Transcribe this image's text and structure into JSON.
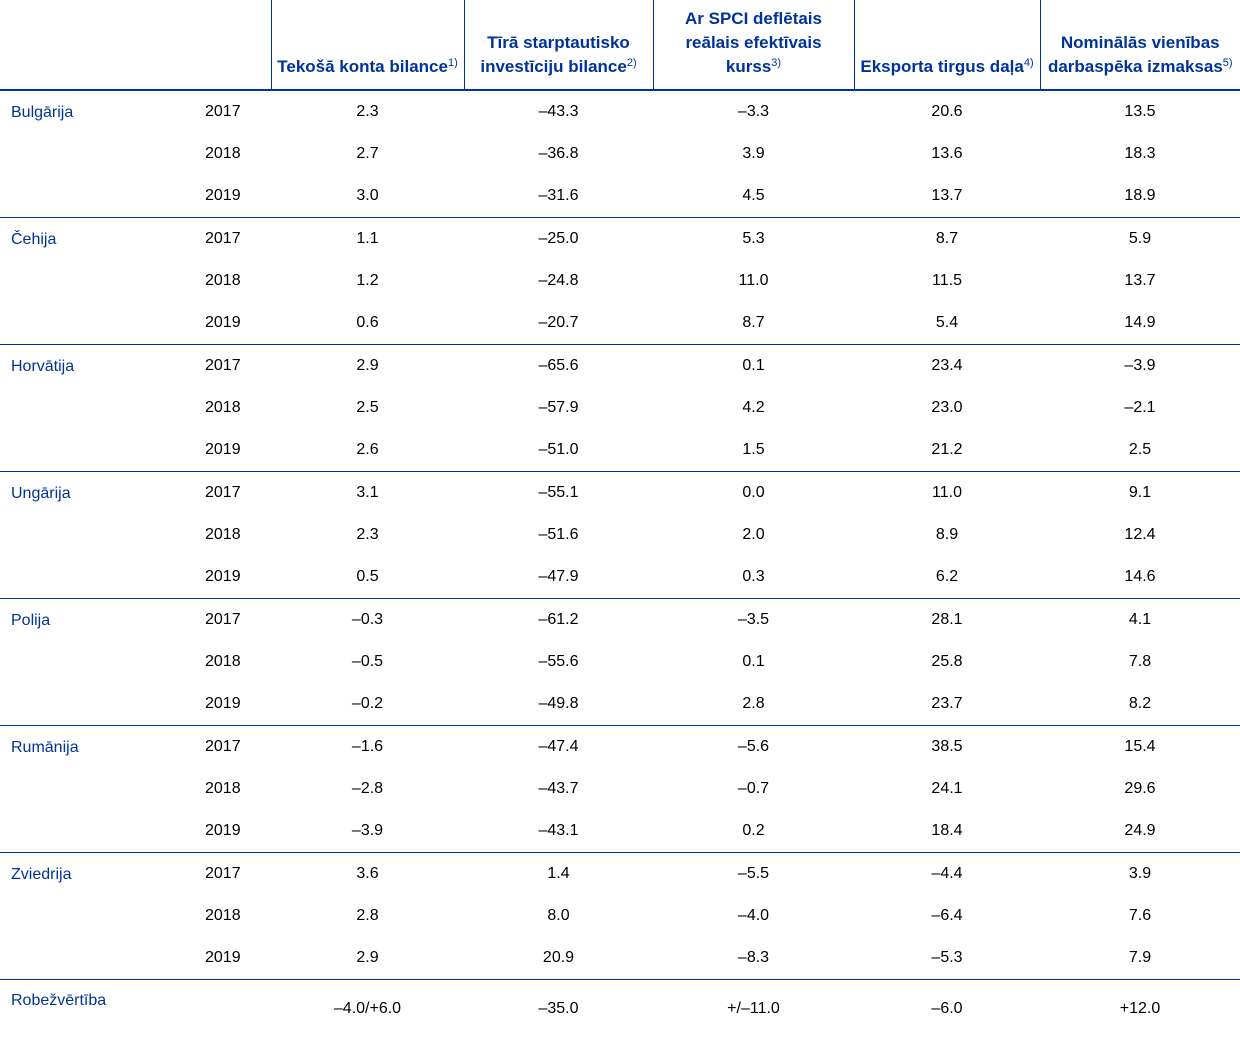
{
  "colors": {
    "accent": "#003399",
    "text": "#000000",
    "background": "#ffffff"
  },
  "header": {
    "columns": [
      {
        "label": "Tekošā konta bilance",
        "note": "1)"
      },
      {
        "label": "Tīrā starptautisko investīciju bilance",
        "note": "2)"
      },
      {
        "label": "Ar SPCI deflētais reālais efektīvais kurss",
        "note": "3)"
      },
      {
        "label": "Eksporta tirgus daļa",
        "note": "4)"
      },
      {
        "label": "Nominālās vienības darbaspēka izmaksas",
        "note": "5)"
      }
    ]
  },
  "groups": [
    {
      "country": "Bulgārija",
      "rows": [
        {
          "year": "2017",
          "values": [
            "2.3",
            "–43.3",
            "–3.3",
            "20.6",
            "13.5"
          ]
        },
        {
          "year": "2018",
          "values": [
            "2.7",
            "–36.8",
            "3.9",
            "13.6",
            "18.3"
          ]
        },
        {
          "year": "2019",
          "values": [
            "3.0",
            "–31.6",
            "4.5",
            "13.7",
            "18.9"
          ]
        }
      ]
    },
    {
      "country": "Čehija",
      "rows": [
        {
          "year": "2017",
          "values": [
            "1.1",
            "–25.0",
            "5.3",
            "8.7",
            "5.9"
          ]
        },
        {
          "year": "2018",
          "values": [
            "1.2",
            "–24.8",
            "11.0",
            "11.5",
            "13.7"
          ]
        },
        {
          "year": "2019",
          "values": [
            "0.6",
            "–20.7",
            "8.7",
            "5.4",
            "14.9"
          ]
        }
      ]
    },
    {
      "country": "Horvātija",
      "rows": [
        {
          "year": "2017",
          "values": [
            "2.9",
            "–65.6",
            "0.1",
            "23.4",
            "–3.9"
          ]
        },
        {
          "year": "2018",
          "values": [
            "2.5",
            "–57.9",
            "4.2",
            "23.0",
            "–2.1"
          ]
        },
        {
          "year": "2019",
          "values": [
            "2.6",
            "–51.0",
            "1.5",
            "21.2",
            "2.5"
          ]
        }
      ]
    },
    {
      "country": "Ungārija",
      "rows": [
        {
          "year": "2017",
          "values": [
            "3.1",
            "–55.1",
            "0.0",
            "11.0",
            "9.1"
          ]
        },
        {
          "year": "2018",
          "values": [
            "2.3",
            "–51.6",
            "2.0",
            "8.9",
            "12.4"
          ]
        },
        {
          "year": "2019",
          "values": [
            "0.5",
            "–47.9",
            "0.3",
            "6.2",
            "14.6"
          ]
        }
      ]
    },
    {
      "country": "Polija",
      "rows": [
        {
          "year": "2017",
          "values": [
            "–0.3",
            "–61.2",
            "–3.5",
            "28.1",
            "4.1"
          ]
        },
        {
          "year": "2018",
          "values": [
            "–0.5",
            "–55.6",
            "0.1",
            "25.8",
            "7.8"
          ]
        },
        {
          "year": "2019",
          "values": [
            "–0.2",
            "–49.8",
            "2.8",
            "23.7",
            "8.2"
          ]
        }
      ]
    },
    {
      "country": "Rumānija",
      "rows": [
        {
          "year": "2017",
          "values": [
            "–1.6",
            "–47.4",
            "–5.6",
            "38.5",
            "15.4"
          ]
        },
        {
          "year": "2018",
          "values": [
            "–2.8",
            "–43.7",
            "–0.7",
            "24.1",
            "29.6"
          ]
        },
        {
          "year": "2019",
          "values": [
            "–3.9",
            "–43.1",
            "0.2",
            "18.4",
            "24.9"
          ]
        }
      ]
    },
    {
      "country": "Zviedrija",
      "rows": [
        {
          "year": "2017",
          "values": [
            "3.6",
            "1.4",
            "–5.5",
            "–4.4",
            "3.9"
          ]
        },
        {
          "year": "2018",
          "values": [
            "2.8",
            "8.0",
            "–4.0",
            "–6.4",
            "7.6"
          ]
        },
        {
          "year": "2019",
          "values": [
            "2.9",
            "20.9",
            "–8.3",
            "–5.3",
            "7.9"
          ]
        }
      ]
    }
  ],
  "threshold": {
    "label": "Robežvērtība",
    "values": [
      "–4.0/+6.0",
      "–35.0",
      "+/–11.0",
      "–6.0",
      "+12.0"
    ]
  }
}
